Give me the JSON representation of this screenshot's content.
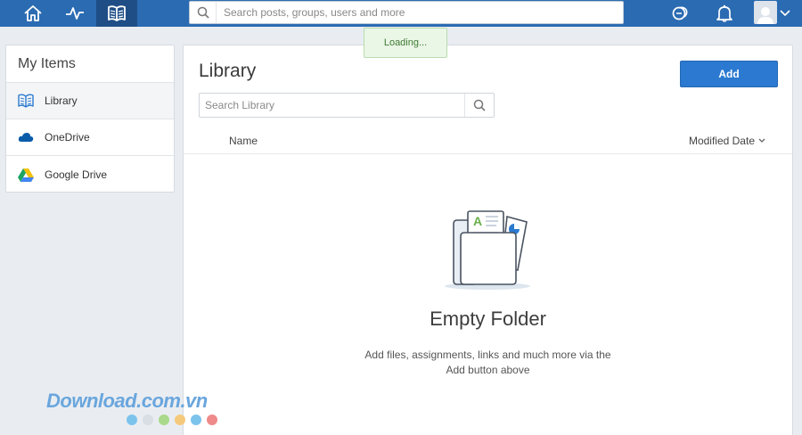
{
  "topbar": {
    "search_placeholder": "Search posts, groups, users and more",
    "nav": [
      "home-icon",
      "activity-icon",
      "library-icon"
    ],
    "right": [
      "backpack-icon",
      "bell-icon",
      "user-avatar",
      "chevron-down-icon"
    ]
  },
  "toast": {
    "text": "Loading..."
  },
  "sidebar": {
    "title": "My Items",
    "items": [
      {
        "label": "Library",
        "icon": "library-icon"
      },
      {
        "label": "OneDrive",
        "icon": "onedrive-cloud-icon"
      },
      {
        "label": "Google Drive",
        "icon": "google-drive-icon"
      }
    ]
  },
  "main": {
    "title": "Library",
    "add_label": "Add",
    "search_placeholder": "Search Library",
    "columns": {
      "name": "Name",
      "modified": "Modified Date"
    },
    "empty": {
      "title": "Empty Folder",
      "line1": "Add files, assignments, links and much more via the",
      "line2": "Add button above"
    }
  },
  "watermark": {
    "text": "Download.com.vn",
    "dot_colors": [
      "#7cc3ec",
      "#d8dee4",
      "#a9d98a",
      "#f5c97b",
      "#7cc3ec",
      "#ef8a8a"
    ]
  },
  "colors": {
    "topbar": "#2b6bb2",
    "accent": "#2b79d0",
    "toast_bg": "#eaf6e6"
  }
}
